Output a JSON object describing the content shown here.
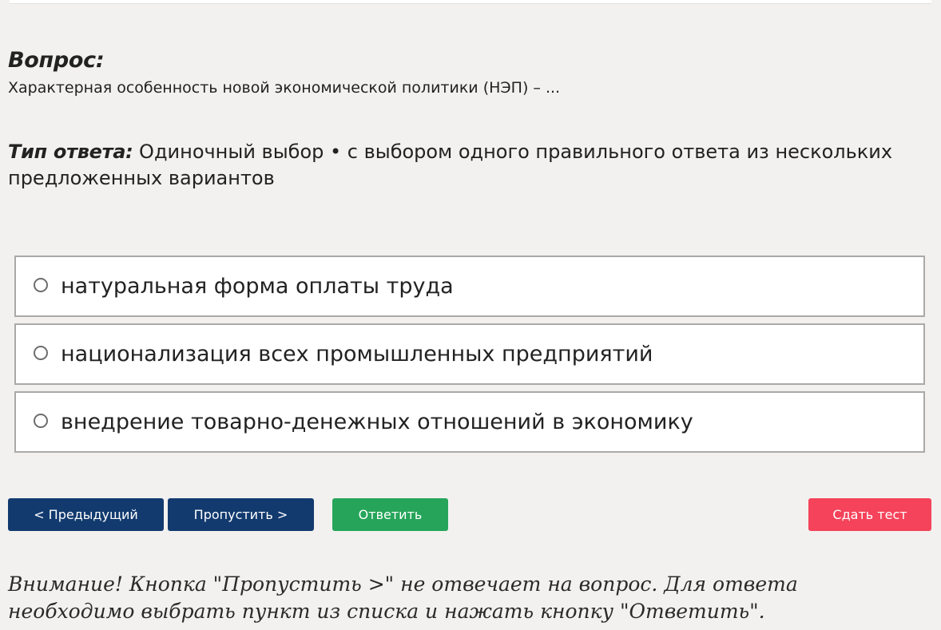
{
  "question": {
    "heading": "Вопрос:",
    "text": "Характерная особенность новой экономической политики (НЭП) – ..."
  },
  "answer_type": {
    "label": "Тип ответа:",
    "value": "Одиночный выбор • с выбором одного правильного ответа из нескольких предложенных вариантов"
  },
  "options": [
    {
      "label": "натуральная форма оплаты труда",
      "selected": false
    },
    {
      "label": "национализация всех промышленных предприятий",
      "selected": false
    },
    {
      "label": "внедрение товарно-денежных отношений в экономику",
      "selected": false
    }
  ],
  "buttons": {
    "previous": "< Предыдущий",
    "skip": "Пропустить >",
    "answer": "Ответить",
    "submit": "Сдать тест"
  },
  "colors": {
    "nav_button": "#123a6e",
    "answer_button": "#26a55a",
    "submit_button": "#f4435a"
  },
  "warning": "Внимание! Кнопка \"Пропустить >\" не отвечает на вопрос. Для ответа необходимо выбрать пункт из списка и нажать кнопку \"Ответить\"."
}
